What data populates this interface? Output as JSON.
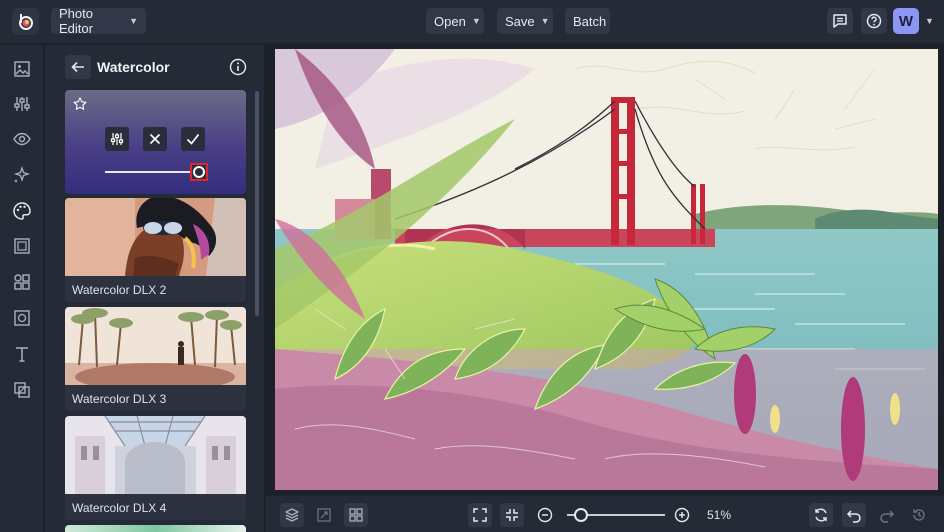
{
  "app": {
    "menu_label": "Photo Editor",
    "actions": {
      "open": "Open",
      "save": "Save",
      "batch": "Batch"
    },
    "user_initial": "W"
  },
  "panel": {
    "title": "Watercolor",
    "active_slider_percent": 100,
    "effects": [
      {
        "label": "Watercolor DLX 2"
      },
      {
        "label": "Watercolor DLX 3"
      },
      {
        "label": "Watercolor DLX 4"
      }
    ]
  },
  "zoom": {
    "level": "51%",
    "slider_percent": 14
  },
  "colors": {
    "accent": "#8b97f2",
    "active_gradient_top": "#6a6b86",
    "active_gradient_bottom": "#342e7e",
    "knob_border": "#e0262d"
  },
  "icons": {
    "rail": [
      "image-icon",
      "sliders-icon",
      "eye-icon",
      "sparkle-icon",
      "palette-icon",
      "frame-icon",
      "shapes-icon",
      "border-icon",
      "text-icon",
      "overlay-icon"
    ]
  }
}
